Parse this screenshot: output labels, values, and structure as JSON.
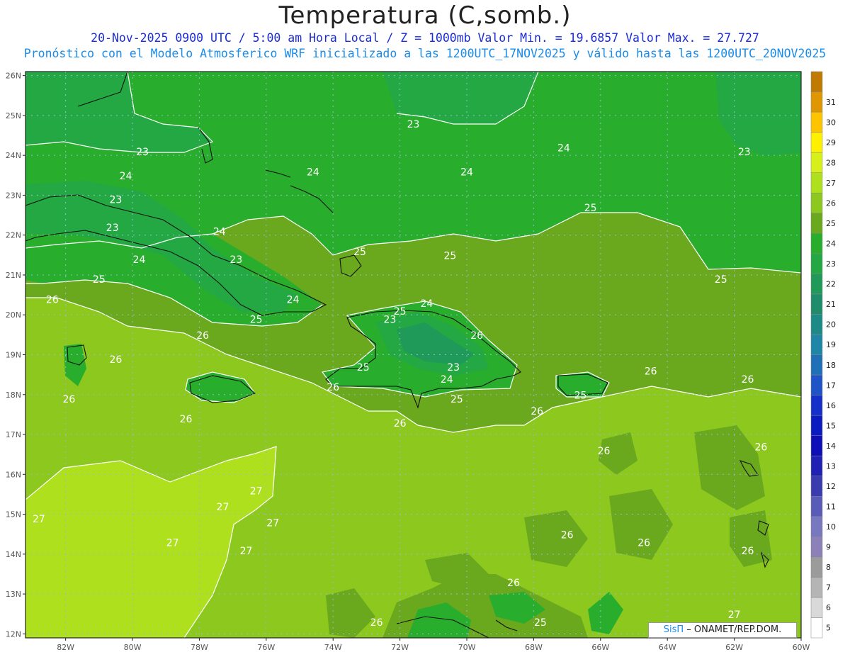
{
  "header": {
    "title": "Temperatura (C,somb.)",
    "subtitle_line1": "20-Nov-2025  0900 UTC / 5:00 am Hora Local / Z = 1000mb    Valor Min. = 19.6857  Valor Max. = 27.727",
    "subtitle_line2": "Pronóstico con el Modelo Atmosferico WRF inicializado a las 1200UTC_17NOV2025 y válido hasta las  1200UTC_20NOV2025"
  },
  "axes": {
    "lat_labels": [
      "26N",
      "25N",
      "24N",
      "23N",
      "22N",
      "21N",
      "20N",
      "19N",
      "18N",
      "17N",
      "16N",
      "15N",
      "14N",
      "13N",
      "12N"
    ],
    "lat_values": [
      26,
      25,
      24,
      23,
      22,
      21,
      20,
      19,
      18,
      17,
      16,
      15,
      14,
      13,
      12
    ],
    "lon_labels": [
      "82W",
      "80W",
      "78W",
      "76W",
      "74W",
      "72W",
      "70W",
      "68W",
      "66W",
      "64W",
      "62W",
      "60W"
    ],
    "lon_values": [
      -82,
      -80,
      -78,
      -76,
      -74,
      -72,
      -70,
      -68,
      -66,
      -64,
      -62,
      -60
    ],
    "lon_range": [
      -83.2,
      -60.0
    ],
    "lat_range": [
      11.9,
      26.1
    ]
  },
  "colorbar": {
    "labels": [
      "5",
      "6",
      "7",
      "8",
      "9",
      "10",
      "11",
      "12",
      "13",
      "14",
      "15",
      "16",
      "17",
      "18",
      "19",
      "20",
      "21",
      "22",
      "23",
      "24",
      "25",
      "26",
      "27",
      "28",
      "29",
      "30",
      "31"
    ],
    "colors": [
      "#ffffff",
      "#d9d9d9",
      "#b5b5b5",
      "#9b9b9b",
      "#8c80b8",
      "#7878c0",
      "#5a5ab8",
      "#3b3bb0",
      "#2020b4",
      "#0e0eb8",
      "#0a1cc0",
      "#1430c8",
      "#1e54c8",
      "#2070b8",
      "#1f86a8",
      "#1e8a88",
      "#1f8c6a",
      "#1f9a58",
      "#23a843",
      "#28ae2c",
      "#6aa81e",
      "#8cc81e",
      "#aee01e",
      "#d8f01a",
      "#fff000",
      "#ffc400",
      "#e09600",
      "#c07a00"
    ]
  },
  "contour_labels": [
    {
      "text": "23",
      "lon": -79.7,
      "lat": 24.0
    },
    {
      "text": "24",
      "lon": -80.2,
      "lat": 23.4
    },
    {
      "text": "23",
      "lon": -80.5,
      "lat": 22.8
    },
    {
      "text": "23",
      "lon": -80.6,
      "lat": 22.1
    },
    {
      "text": "24",
      "lon": -79.8,
      "lat": 21.3
    },
    {
      "text": "25",
      "lon": -81.0,
      "lat": 20.8
    },
    {
      "text": "24",
      "lon": -77.4,
      "lat": 22.0
    },
    {
      "text": "23",
      "lon": -76.9,
      "lat": 21.3
    },
    {
      "text": "24",
      "lon": -75.2,
      "lat": 20.3
    },
    {
      "text": "25",
      "lon": -76.3,
      "lat": 19.8
    },
    {
      "text": "26",
      "lon": -82.4,
      "lat": 20.3
    },
    {
      "text": "26",
      "lon": -77.9,
      "lat": 19.4
    },
    {
      "text": "24",
      "lon": -74.6,
      "lat": 23.5
    },
    {
      "text": "25",
      "lon": -73.2,
      "lat": 21.5
    },
    {
      "text": "25",
      "lon": -70.5,
      "lat": 21.4
    },
    {
      "text": "23",
      "lon": -71.6,
      "lat": 24.7
    },
    {
      "text": "24",
      "lon": -70.0,
      "lat": 23.5
    },
    {
      "text": "24",
      "lon": -67.1,
      "lat": 24.1
    },
    {
      "text": "25",
      "lon": -66.3,
      "lat": 22.6
    },
    {
      "text": "23",
      "lon": -61.7,
      "lat": 24.0
    },
    {
      "text": "25",
      "lon": -62.4,
      "lat": 20.8
    },
    {
      "text": "25",
      "lon": -72.0,
      "lat": 20.0
    },
    {
      "text": "24",
      "lon": -71.2,
      "lat": 20.2
    },
    {
      "text": "23",
      "lon": -72.3,
      "lat": 19.8
    },
    {
      "text": "26",
      "lon": -69.7,
      "lat": 19.4
    },
    {
      "text": "25",
      "lon": -73.1,
      "lat": 18.6
    },
    {
      "text": "26",
      "lon": -74.0,
      "lat": 18.1
    },
    {
      "text": "23",
      "lon": -70.4,
      "lat": 18.6
    },
    {
      "text": "24",
      "lon": -70.6,
      "lat": 18.3
    },
    {
      "text": "25",
      "lon": -70.3,
      "lat": 17.8
    },
    {
      "text": "25",
      "lon": -66.6,
      "lat": 17.9
    },
    {
      "text": "26",
      "lon": -67.9,
      "lat": 17.5
    },
    {
      "text": "26",
      "lon": -64.5,
      "lat": 18.5
    },
    {
      "text": "26",
      "lon": -61.6,
      "lat": 18.3
    },
    {
      "text": "26",
      "lon": -80.5,
      "lat": 18.8
    },
    {
      "text": "26",
      "lon": -81.9,
      "lat": 17.8
    },
    {
      "text": "26",
      "lon": -78.4,
      "lat": 17.3
    },
    {
      "text": "26",
      "lon": -72.0,
      "lat": 17.2
    },
    {
      "text": "26",
      "lon": -65.9,
      "lat": 16.5
    },
    {
      "text": "26",
      "lon": -61.2,
      "lat": 16.6
    },
    {
      "text": "27",
      "lon": -76.3,
      "lat": 15.5
    },
    {
      "text": "27",
      "lon": -77.3,
      "lat": 15.1
    },
    {
      "text": "27",
      "lon": -82.8,
      "lat": 14.8
    },
    {
      "text": "27",
      "lon": -75.8,
      "lat": 14.7
    },
    {
      "text": "27",
      "lon": -78.8,
      "lat": 14.2
    },
    {
      "text": "27",
      "lon": -76.6,
      "lat": 14.0
    },
    {
      "text": "26",
      "lon": -67.0,
      "lat": 14.4
    },
    {
      "text": "26",
      "lon": -64.7,
      "lat": 14.2
    },
    {
      "text": "26",
      "lon": -61.6,
      "lat": 14.0
    },
    {
      "text": "26",
      "lon": -68.6,
      "lat": 13.2
    },
    {
      "text": "25",
      "lon": -67.8,
      "lat": 12.2
    },
    {
      "text": "26",
      "lon": -72.7,
      "lat": 12.2
    },
    {
      "text": "27",
      "lon": -62.0,
      "lat": 12.4
    }
  ],
  "credit": {
    "brand": "SisΠ",
    "text": " – ONAMET/REP.DOM."
  }
}
